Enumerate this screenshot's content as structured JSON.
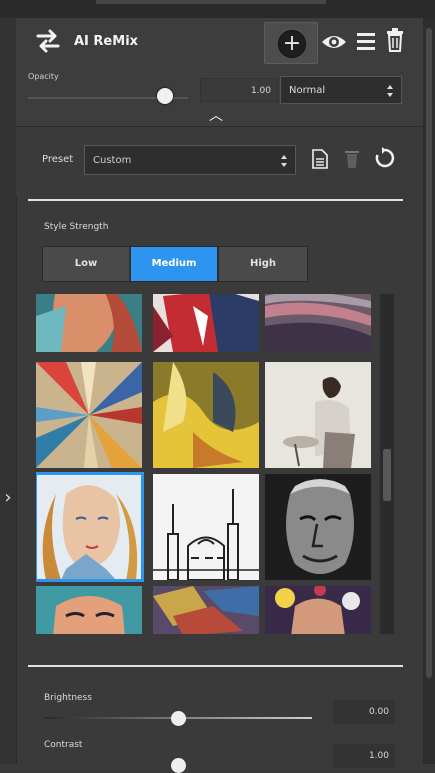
{
  "panel": {
    "title": "AI ReMix",
    "opacity_label": "Opacity",
    "opacity_value": "1.00",
    "opacity_level": 1.0,
    "blend_mode": "Normal",
    "preset_label": "Preset",
    "preset_value": "Custom",
    "style_strength_label": "Style Strength",
    "strength_options": [
      "Low",
      "Medium",
      "High"
    ],
    "strength_selected": "Medium",
    "brightness_label": "Brightness",
    "brightness_value": "0.00",
    "contrast_label": "Contrast",
    "contrast_value": "1.00"
  },
  "colors": {
    "accent": "#2d95f0",
    "panel_bg": "#3a3a3a",
    "divider": "#e2e2e2"
  },
  "icons": [
    "swap-arrows-icon",
    "add-circle-icon",
    "eye-icon",
    "menu-icon",
    "trash-icon",
    "document-icon",
    "reset-icon",
    "chevron-up-icon",
    "chevron-right-icon"
  ],
  "style_grid": {
    "selected_index": 6,
    "styles": [
      "style-1",
      "style-2",
      "style-3",
      "style-4",
      "style-5",
      "style-6",
      "style-7",
      "style-8",
      "style-9",
      "style-10",
      "style-11",
      "style-12"
    ]
  }
}
